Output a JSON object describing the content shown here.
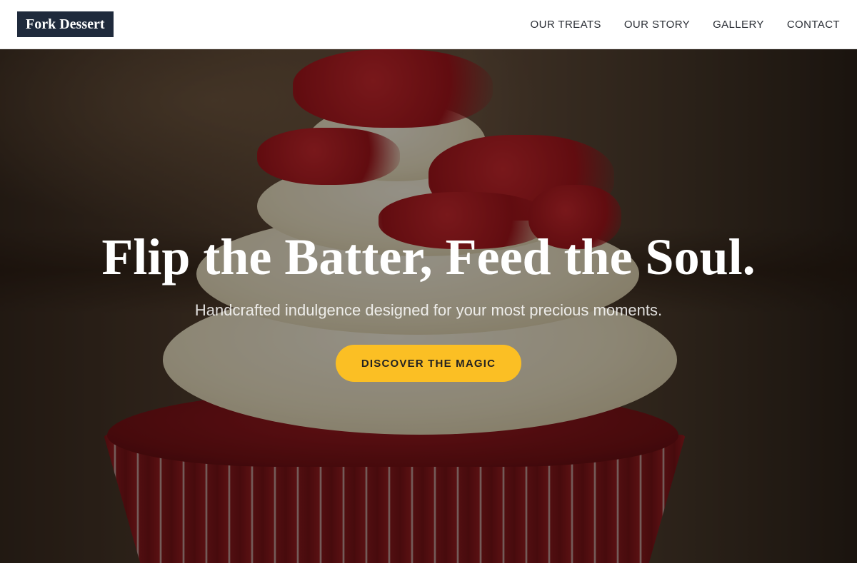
{
  "header": {
    "logo_text": "Fork Dessert",
    "nav": [
      {
        "label": "OUR TREATS"
      },
      {
        "label": "OUR STORY"
      },
      {
        "label": "GALLERY"
      },
      {
        "label": "CONTACT"
      }
    ]
  },
  "hero": {
    "headline": "Flip the Batter, Feed the Soul.",
    "subheadline": "Handcrafted indulgence designed for your most precious moments.",
    "cta_label": "DISCOVER THE MAGIC"
  },
  "colors": {
    "logo_bg": "#1f2a3c",
    "cta_bg": "#fbbf24",
    "nav_text": "#2b2f36"
  }
}
